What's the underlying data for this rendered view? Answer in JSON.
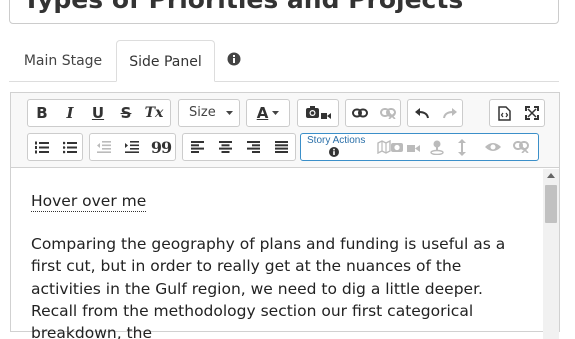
{
  "title": {
    "value": "Types of Priorities and Projects"
  },
  "tabs": [
    {
      "label": "Main Stage",
      "active": false
    },
    {
      "label": "Side Panel",
      "active": true
    }
  ],
  "toolbar": {
    "bold": "B",
    "italic": "I",
    "underline": "U",
    "strike": "S",
    "clear_format": "Tx",
    "size_label": "Size",
    "font_color": "A",
    "blockquote": "99",
    "story_actions_label": "Story Actions"
  },
  "content": {
    "hover_text": "Hover over me",
    "paragraph": "Comparing the geography of plans and funding is useful as a first cut, but in order to really get at the nuances of the activities in the Gulf region, we need to dig a little deeper. Recall from the methodology section our first categorical breakdown, the"
  },
  "colors": {
    "accent_border": "#3b8fc9",
    "tab_border": "#dddddd",
    "toolbar_bg": "#f8f8f8"
  }
}
